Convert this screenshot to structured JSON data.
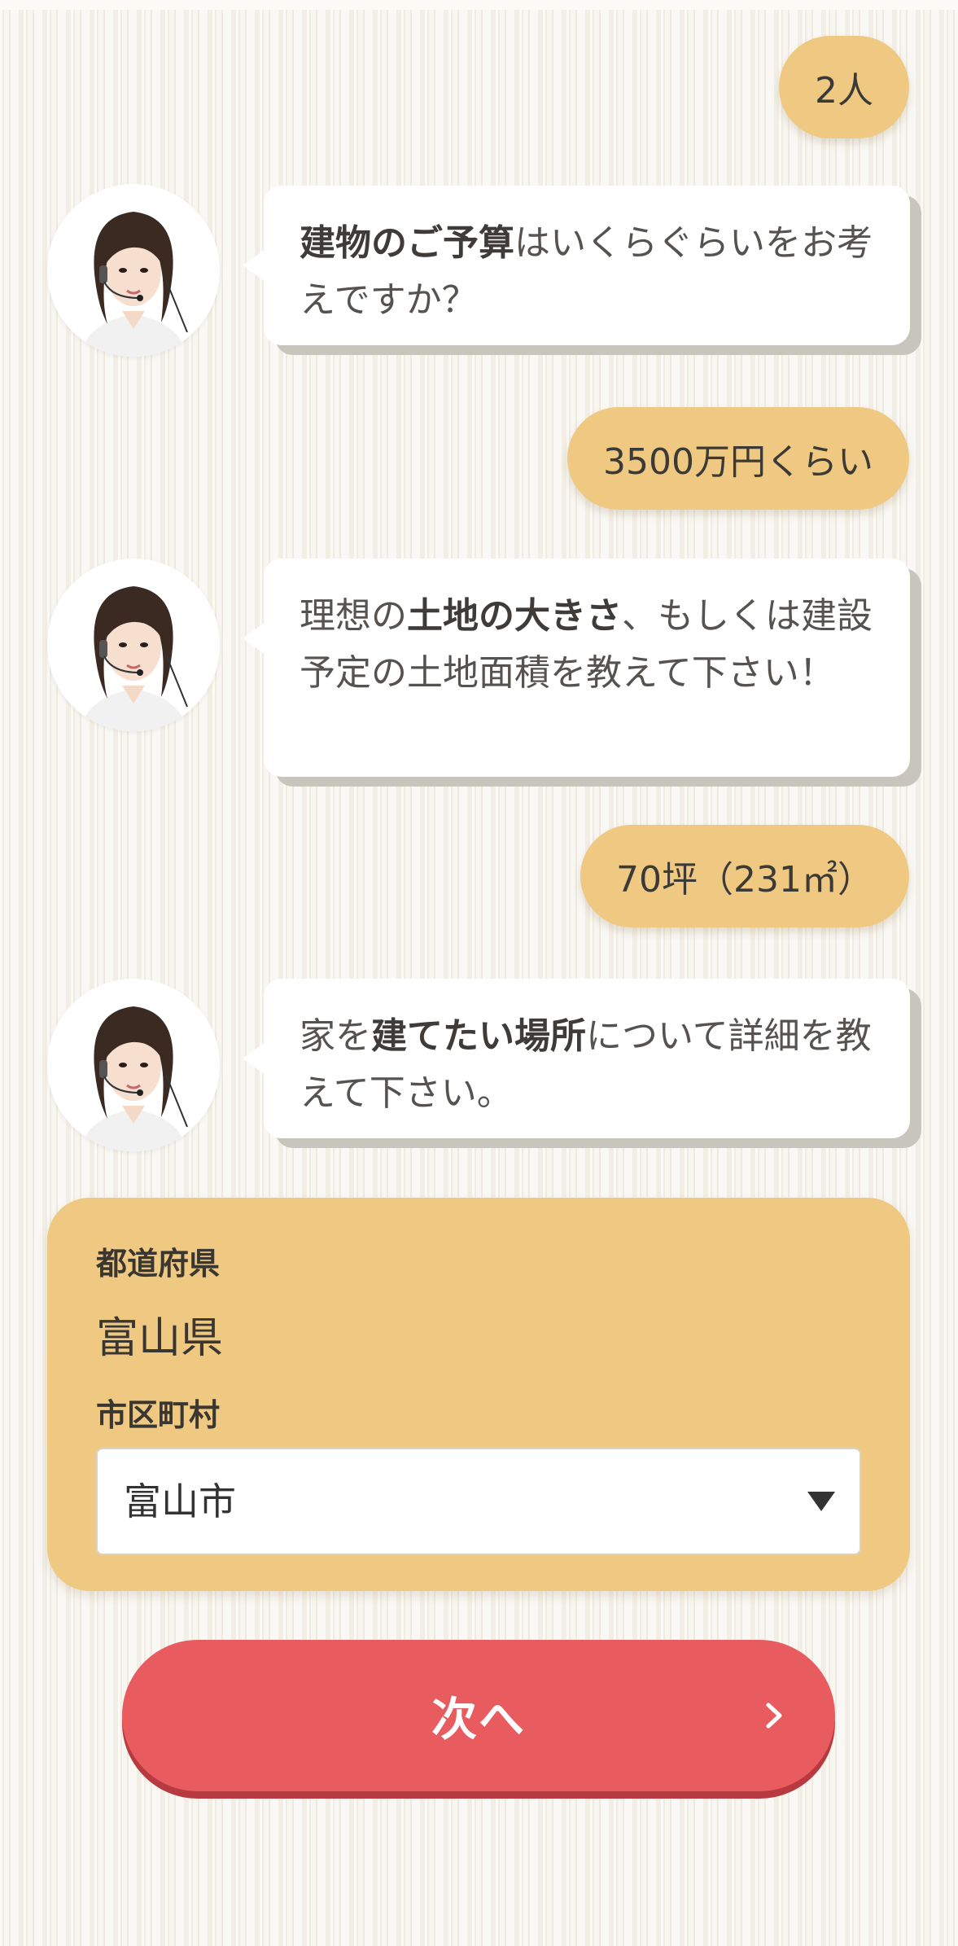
{
  "messages": {
    "user_people": "2人",
    "bot_budget": {
      "bold": "建物のご予算",
      "rest": "はいくらぐらいをお考えですか？"
    },
    "user_budget": "3500万円くらい",
    "bot_land": {
      "pre": "理想の",
      "bold": "土地の大きさ",
      "rest": "、もしくは建設予定の土地面積を教えて下さい！"
    },
    "user_land": "70坪（231㎡）",
    "bot_location": {
      "pre": "家を",
      "bold": "建てたい場所",
      "rest": "について詳細を教えて下さい。"
    }
  },
  "form": {
    "prefecture_label": "都道府県",
    "prefecture_value": "富山県",
    "city_label": "市区町村",
    "city_selected": "富山市"
  },
  "next_button": {
    "label": "次へ"
  },
  "colors": {
    "user_bubble": "#efc982",
    "next_button": "#e85c5f",
    "panel": "#efc982"
  },
  "icons": {
    "operator_avatar": "operator-avatar-icon",
    "dropdown": "triangle-down-icon",
    "next": "chevron-right-icon"
  }
}
